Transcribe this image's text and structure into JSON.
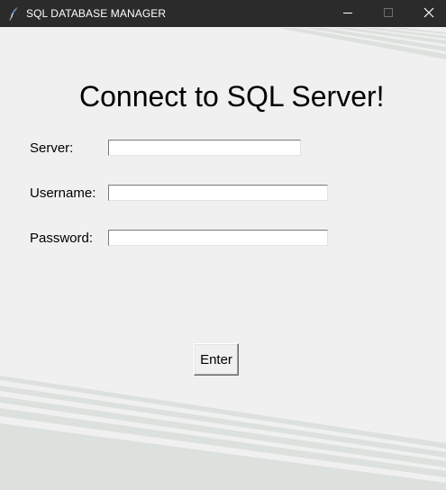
{
  "window": {
    "title": "SQL DATABASE MANAGER",
    "icon": "feather-icon",
    "controls": {
      "minimize": "minimize-icon",
      "maximize": "maximize-icon",
      "close": "close-icon"
    }
  },
  "form": {
    "heading": "Connect to SQL Server!",
    "server_label": "Server:",
    "server_value": "",
    "username_label": "Username:",
    "username_value": "",
    "password_label": "Password:",
    "password_value": "",
    "enter_label": "Enter"
  },
  "colors": {
    "titlebar": "#2b2b2b",
    "background": "#f0f0f0",
    "stripe": "#dfe3df"
  }
}
